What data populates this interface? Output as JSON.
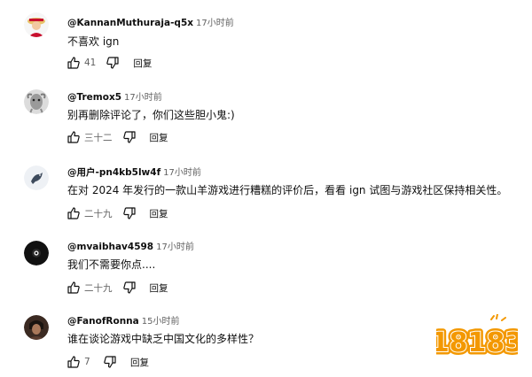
{
  "comments": [
    {
      "author": "@KannanMuthuraja-q5x",
      "time": "17小时前",
      "text": "不喜欢 ign",
      "likes": "41",
      "reply_label": "回复",
      "avatar_icon": "avatar-cartoon-icon",
      "avatar_color": "#c8102e"
    },
    {
      "author": "@Tremox5",
      "time": "17小时前",
      "text": "别再删除评论了，你们这些胆小鬼:)",
      "likes": "三十二",
      "reply_label": "回复",
      "avatar_icon": "avatar-doodle-icon",
      "avatar_color": "#cfcfcf"
    },
    {
      "author": "@用户-pn4kb5lw4f",
      "time": "17小时前",
      "text": "在对 2024 年发行的一款山羊游戏进行糟糕的评价后，看看 ign 试图与游戏社区保持相关性。",
      "likes": "二十九",
      "reply_label": "回复",
      "avatar_icon": "avatar-bird-icon",
      "avatar_color": "#eef1f5"
    },
    {
      "author": "@mvaibhav4598",
      "time": "17小时前",
      "text": "我们不需要你点....",
      "likes": "二十九",
      "reply_label": "回复",
      "avatar_icon": "avatar-eye-icon",
      "avatar_color": "#111111"
    },
    {
      "author": "@FanofRonna",
      "time": "15小时前",
      "text": "谁在谈论游戏中缺乏中国文化的多样性？",
      "likes": "7",
      "reply_label": "回复",
      "avatar_icon": "avatar-portrait-icon",
      "avatar_color": "#3b2a22"
    }
  ],
  "watermark": {
    "text": "18183",
    "icon": "logo-18183-icon",
    "color": "#f39800"
  }
}
